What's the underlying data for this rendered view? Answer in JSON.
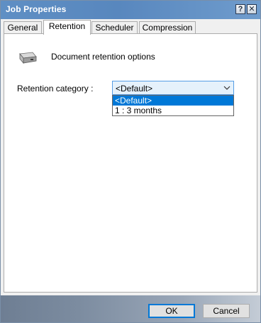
{
  "window": {
    "title": "Job Properties",
    "help_glyph": "?",
    "close_glyph": "✕"
  },
  "tabs": [
    {
      "label": "General",
      "active": false
    },
    {
      "label": "Retention",
      "active": true
    },
    {
      "label": "Scheduler",
      "active": false
    },
    {
      "label": "Compression",
      "active": false
    }
  ],
  "retention": {
    "section_label": "Document retention options",
    "category_label": "Retention category :",
    "category_value": "<Default>",
    "options": [
      "<Default>",
      "1 : 3 months"
    ],
    "highlighted_option": "<Default>"
  },
  "buttons": {
    "ok_label": "OK",
    "cancel_label": "Cancel"
  },
  "icons": {
    "section_icon": "hard-drive-icon",
    "combo_arrow": "chevron-down-icon"
  },
  "colors": {
    "title_bar": "#5887be",
    "selection": "#0078d7",
    "combo_focus_border": "#569de5"
  }
}
